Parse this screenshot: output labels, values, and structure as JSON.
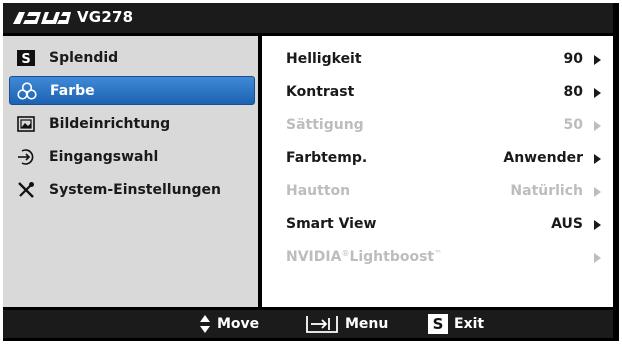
{
  "header": {
    "brand": "ASUS",
    "model": "VG278"
  },
  "sidebar": {
    "items": [
      {
        "label": "Splendid",
        "icon": "splendid-s-icon",
        "selected": false
      },
      {
        "label": "Farbe",
        "icon": "color-circles-icon",
        "selected": true
      },
      {
        "label": "Bildeinrichtung",
        "icon": "picture-icon",
        "selected": false
      },
      {
        "label": "Eingangswahl",
        "icon": "input-arrow-icon",
        "selected": false
      },
      {
        "label": "System-Einstellungen",
        "icon": "tools-icon",
        "selected": false
      }
    ]
  },
  "settings": {
    "rows": [
      {
        "label": "Helligkeit",
        "value": "90",
        "enabled": true
      },
      {
        "label": "Kontrast",
        "value": "80",
        "enabled": true
      },
      {
        "label": "Sättigung",
        "value": "50",
        "enabled": false
      },
      {
        "label": "Farbtemp.",
        "value": "Anwender",
        "enabled": true
      },
      {
        "label": "Hautton",
        "value": "Natürlich",
        "enabled": false
      },
      {
        "label": "Smart View",
        "value": "AUS",
        "enabled": true
      },
      {
        "label": "NVIDIA",
        "label_mark1": "®",
        "label_tail": "Lightboost",
        "label_mark2": "™",
        "value": "",
        "enabled": false
      }
    ]
  },
  "footer": {
    "move_label": "Move",
    "menu_label": "Menu",
    "exit_label": "Exit",
    "exit_key": "S"
  },
  "colors": {
    "selected_bg": "#2f78c8",
    "panel_gray": "#d9d9d9",
    "bar_dark": "#1b1b1b",
    "disabled_text": "#bdbdbd"
  }
}
